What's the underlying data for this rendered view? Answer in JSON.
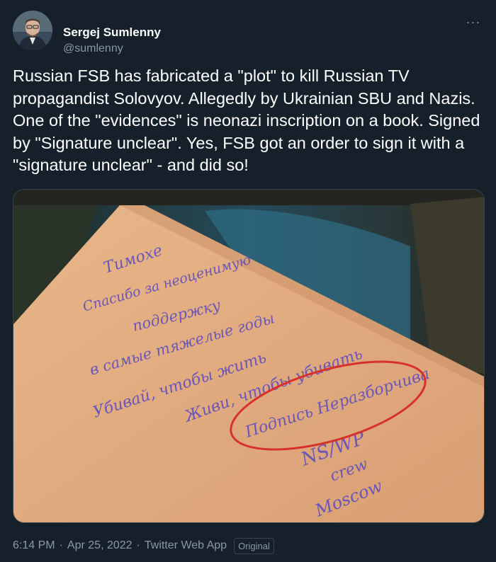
{
  "author": {
    "name": "Sergej Sumlenny",
    "handle": "@sumlenny"
  },
  "menu": {
    "more_label": "···"
  },
  "tweet": {
    "text": "Russian FSB has fabricated a \"plot\" to kill Russian TV propagandist Solovyov. Allegedly by Ukrainian SBU and Nazis. One of the \"evidences\" is neonazi inscription on a book. Signed by \"Signature unclear\". Yes, FSB got an order to sign it with a \"signature unclear\" - and did so!"
  },
  "media": {
    "handwriting": [
      "Тимохе",
      "Спасибо за неоценимую",
      "поддержку",
      "в самые тяжелые годы",
      "Убивай, чтобы жить",
      "Живи, чтобы убивать",
      "Подпись Неразборчива",
      "NS/WP",
      "crew",
      "Moscow"
    ]
  },
  "footer": {
    "time": "6:14 PM",
    "date": "Apr 25, 2022",
    "source": "Twitter Web App",
    "badge": "Original",
    "separator": "·"
  },
  "colors": {
    "background": "#15202b",
    "secondary_text": "#8b98a5",
    "annotation_circle": "#d8302a"
  }
}
